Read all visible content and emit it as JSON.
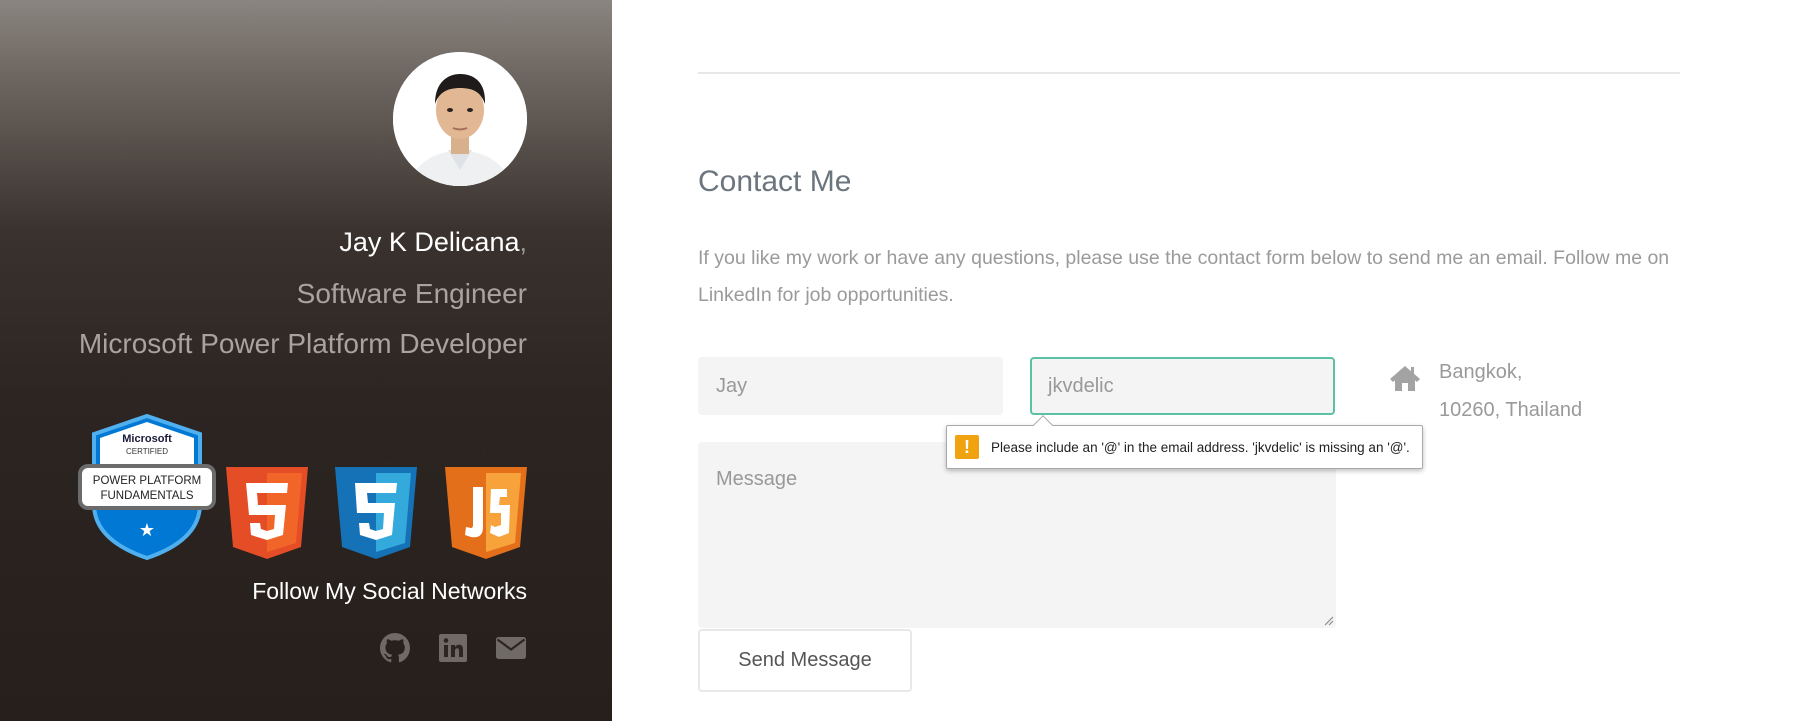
{
  "sidebar": {
    "name": "Jay K Delicana",
    "name_comma": ",",
    "role_1": "Software Engineer",
    "role_2": "Microsoft Power Platform Developer",
    "badges": {
      "ms_top": "Microsoft",
      "ms_sub": "CERTIFIED",
      "ms_line1": "POWER PLATFORM",
      "ms_line2": "FUNDAMENTALS",
      "html_label": "HTML",
      "css_label": "CSS",
      "js_label": "JS"
    },
    "follow_title": "Follow My Social Networks",
    "social_icons": [
      "github-icon",
      "linkedin-icon",
      "envelope-icon"
    ]
  },
  "main": {
    "heading": "Contact Me",
    "intro": "If you like my work or have any questions, please use the contact form below to send me an email. Follow me on LinkedIn for job opportunities.",
    "form": {
      "name_value": "Jay",
      "email_value": "jkvdelic",
      "message_placeholder": "Message",
      "send_label": "Send Message"
    },
    "address": {
      "line_1": "Bangkok,",
      "line_2": "10260, Thailand"
    },
    "validation": {
      "icon": "!",
      "message": "Please include an '@' in the email address. 'jkvdelic' is missing an '@'."
    }
  },
  "colors": {
    "accent_focus": "#5cc0a4",
    "warning": "#f1a30f",
    "html5": "#e44d26",
    "css3": "#1572b6",
    "js": "#f58220",
    "ms_badge_blue": "#0078d4"
  }
}
